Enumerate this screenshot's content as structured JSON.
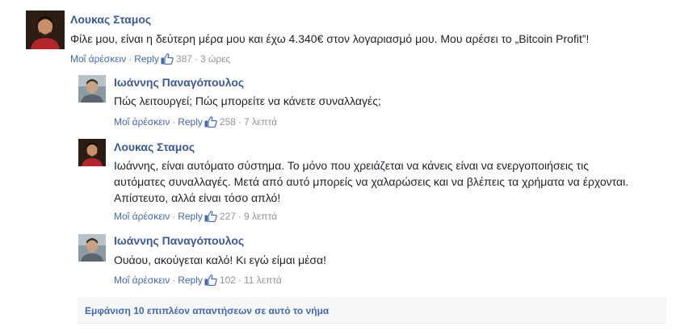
{
  "comments": [
    {
      "author": "Λουκας Σταμος",
      "text": "Φίλε μου, είναι η δεύτερη μέρα μου και έχω 4.340€ στον λογαριασμό μου. Μου αρέσει το „Bitcoin Profit”!",
      "like_label": "Μοΐ άρέσκειν",
      "reply_label": "Reply",
      "likes": "387",
      "time": "3 ώρες"
    },
    {
      "author": "Ιωάννης Παναγόπουλος",
      "text": "Πώς λειτουργεί; Πώς μπορείτε να κάνετε συναλλαγές;",
      "like_label": "Μοΐ άρέσκειν",
      "reply_label": "Reply",
      "likes": "258",
      "time": "7 λεπτά"
    },
    {
      "author": "Λουκας Σταμος",
      "text_lines": [
        "Ιωάννης, είναι αυτόματο σύστημα. Το μόνο που χρειάζεται να κάνεις είναι να ενεργοποιήσεις τις",
        "αυτόματες συναλλαγές. Μετά από αυτό μπορείς να χαλαρώσεις και να βλέπεις τα χρήματα να έρχονται.",
        "Απίστευτο, αλλά είναι τόσο απλό!"
      ],
      "like_label": "Μοΐ άρέσκειν",
      "reply_label": "Reply",
      "likes": "227",
      "time": "9 λεπτά"
    },
    {
      "author": "Ιωάννης Παναγόπουλος",
      "text": "Ουάου, ακούγεται καλό! Κι εγώ είμαι μέσα!",
      "like_label": "Μοΐ άρέσκειν",
      "reply_label": "Reply",
      "likes": "102",
      "time": "11 λεπτά"
    }
  ],
  "more_replies": "Εμφάνιση 10 επιπλέον απαντήσεων σε αυτό το νήμα",
  "colors": {
    "name": "#3b5998",
    "link": "#4267b2",
    "meta": "#90949c",
    "bar": "#f6f7f9"
  }
}
